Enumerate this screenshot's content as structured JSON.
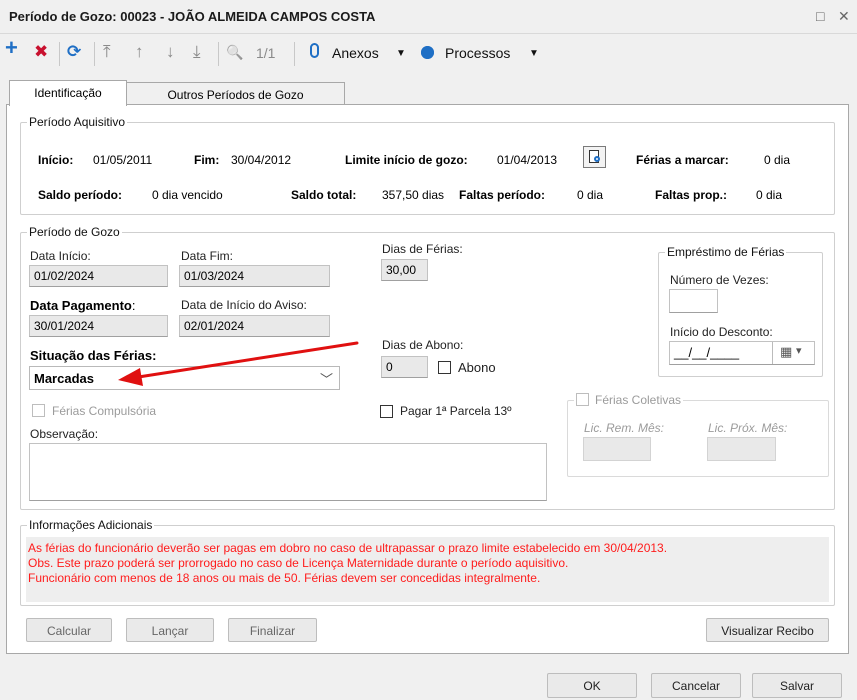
{
  "window": {
    "title": "Período de Gozo: 00023 - JOÃO ALMEIDA CAMPOS COSTA",
    "restore_icon": "□",
    "close_icon": "✕"
  },
  "toolbar": {
    "add_icon": "+",
    "delete_icon": "✖",
    "refresh_icon": "⟳",
    "first_icon": "⤒",
    "prev_icon": "↑",
    "next_icon": "↓",
    "last_icon": "⤓",
    "search_icon": "🔍",
    "page_indicator": "1/1",
    "attachments_label": "Anexos",
    "processes_label": "Processos",
    "dropdown_caret": "▼"
  },
  "tabs": [
    {
      "label": "Identificação"
    },
    {
      "label": "Outros Períodos de Gozo"
    }
  ],
  "acquisitive": {
    "legend": "Período Aquisitivo",
    "start_label": "Início:",
    "start_value": "01/05/2011",
    "end_label": "Fim:",
    "end_value": "30/04/2012",
    "limit_label": "Limite início de gozo:",
    "limit_value": "01/04/2013",
    "to_mark_label": "Férias a marcar:",
    "to_mark_value": "0 dia",
    "period_balance_label": "Saldo período:",
    "period_balance_value": "0 dia vencido",
    "total_balance_label": "Saldo total:",
    "total_balance_value": "357,50 dias",
    "absences_label": "Faltas período:",
    "absences_value": "0 dia",
    "prop_absences_label": "Faltas prop.:",
    "prop_absences_value": "0 dia"
  },
  "enjoyment": {
    "legend": "Período de Gozo",
    "start_date_label": "Data Início:",
    "start_date_value": "01/02/2024",
    "end_date_label": "Data Fim:",
    "end_date_value": "01/03/2024",
    "vacation_days_label": "Dias de Férias:",
    "vacation_days_value": "30,00",
    "payment_date_label": "Data Pagamento",
    "payment_date_colon": ":",
    "payment_date_value": "30/01/2024",
    "notice_date_label": "Data de Início do Aviso:",
    "notice_date_value": "02/01/2024",
    "status_label": "Situação das Férias:",
    "status_value": "Marcadas",
    "status_caret": "﹀",
    "bonus_days_label": "Dias de Abono:",
    "bonus_days_value": "0",
    "bonus_check_label": "Abono",
    "compulsory_label": "Férias Compulsória",
    "first_installment_label": "Pagar 1ª Parcela 13º",
    "notes_label": "Observação:",
    "notes_value": ""
  },
  "loan": {
    "legend": "Empréstimo de Férias",
    "times_label": "Número de Vezes:",
    "times_value": "",
    "discount_start_label": "Início do Desconto:",
    "discount_start_value": "__/__/____",
    "calendar_icon": "▦",
    "caret": "▾"
  },
  "collective": {
    "legend": "Férias Coletivas",
    "rem_label": "Lic. Rem. Mês:",
    "next_label": "Lic. Próx. Mês:"
  },
  "additional_info": {
    "legend": "Informações Adicionais",
    "lines": [
      "As férias do funcionário deverão ser pagas em dobro no caso de ultrapassar o prazo limite estabelecido em 30/04/2013.",
      "Obs. Este prazo poderá ser prorrogado no caso de Licença Maternidade durante o período aquisitivo.",
      "Funcionário com menos de 18 anos ou mais de 50. Férias devem ser concedidas integralmente."
    ]
  },
  "actions": {
    "calculate": "Calcular",
    "post": "Lançar",
    "finalize": "Finalizar",
    "view_receipt": "Visualizar Recibo"
  },
  "footer": {
    "ok": "OK",
    "cancel": "Cancelar",
    "save": "Salvar"
  },
  "colors": {
    "accent_blue": "#1f6fc5",
    "delete_red": "#c8102e",
    "warning_red": "#ff1c1c",
    "annotation_arrow": "#e01010"
  }
}
